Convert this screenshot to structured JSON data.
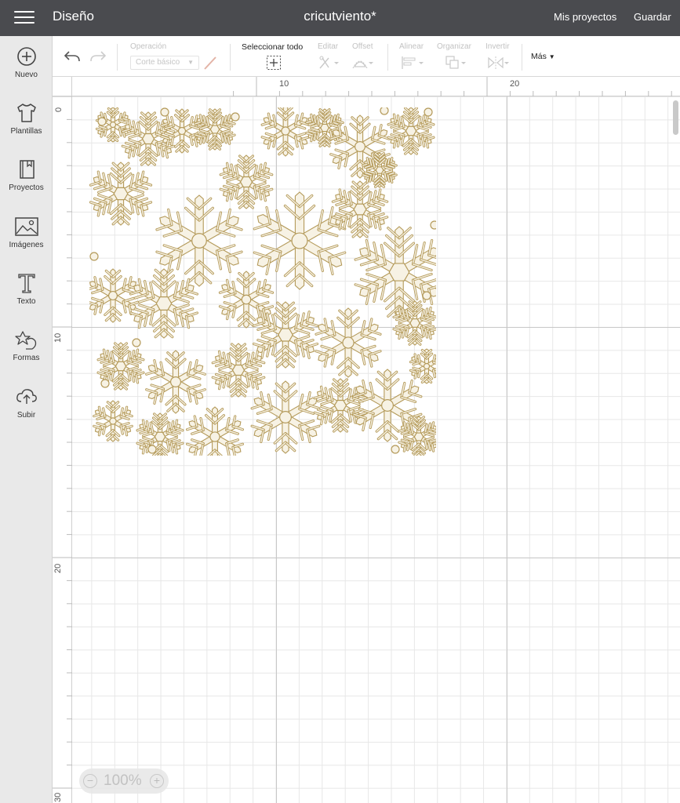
{
  "header": {
    "section_title": "Diseño",
    "project_title": "cricutviento*",
    "my_projects": "Mis proyectos",
    "save": "Guardar"
  },
  "sidebar": {
    "items": [
      {
        "label": "Nuevo",
        "icon": "plus-circle-icon"
      },
      {
        "label": "Plantillas",
        "icon": "tshirt-icon"
      },
      {
        "label": "Proyectos",
        "icon": "notebook-icon"
      },
      {
        "label": "Imágenes",
        "icon": "image-icon"
      },
      {
        "label": "Texto",
        "icon": "text-t-icon"
      },
      {
        "label": "Formas",
        "icon": "shapes-icon"
      },
      {
        "label": "Subir",
        "icon": "cloud-upload-icon"
      }
    ]
  },
  "toolbar": {
    "operation_label": "Operación",
    "operation_value": "Corte básico",
    "select_all_label": "Seleccionar todo",
    "edit_label": "Editar",
    "offset_label": "Offset",
    "align_label": "Alinear",
    "arrange_label": "Organizar",
    "flip_label": "Invertir",
    "more_label": "Más"
  },
  "rulers": {
    "top": [
      "10",
      "20"
    ],
    "left": [
      "0",
      "10",
      "20",
      "30"
    ]
  },
  "zoom": {
    "value": "100%"
  },
  "colors": {
    "header_bg": "#4a4b4f",
    "design_stroke": "#b49a5a",
    "design_fill": "#f7f2e4"
  }
}
